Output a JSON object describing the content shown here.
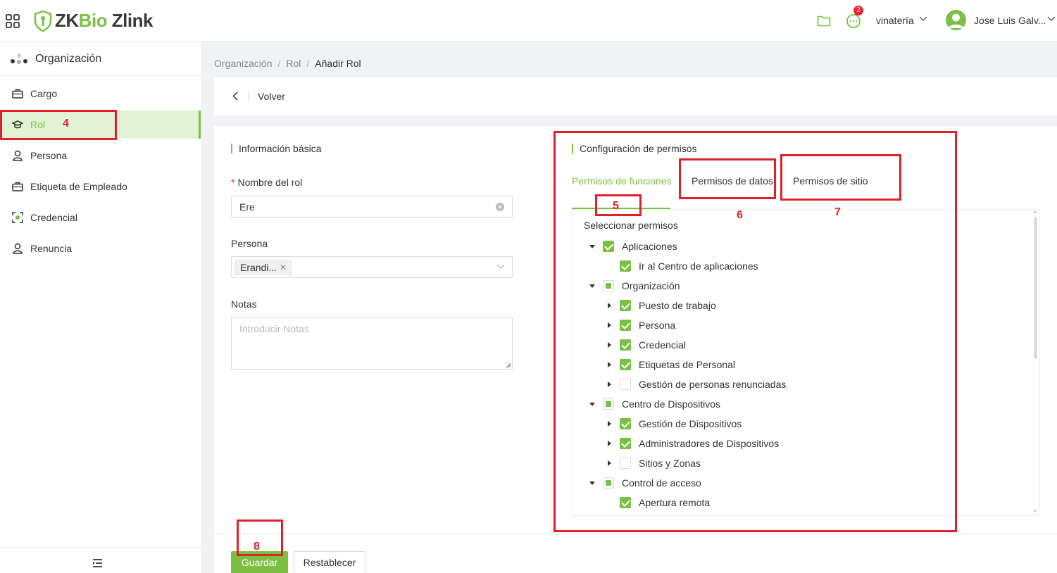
{
  "header": {
    "logo_zk": "ZK",
    "logo_bio": "Bio",
    "logo_zlink": " Zlink",
    "notification_count": "2",
    "company": "vinatería",
    "username": "Jose Luis Galv..."
  },
  "sidebar": {
    "title": "Organización",
    "items": [
      {
        "label": "Cargo",
        "icon": "briefcase-icon"
      },
      {
        "label": "Rol",
        "icon": "graduation-cap-icon",
        "active": true
      },
      {
        "label": "Persona",
        "icon": "person-icon"
      },
      {
        "label": "Etiqueta de Empleado",
        "icon": "briefcase-icon"
      },
      {
        "label": "Credencial",
        "icon": "credential-icon"
      },
      {
        "label": "Renuncia",
        "icon": "person-icon"
      }
    ]
  },
  "breadcrumb": [
    "Organización",
    "Rol",
    "Añadir Rol"
  ],
  "back_label": "Volver",
  "basic_info": {
    "title": "Información básica",
    "role_name_label": "Nombre del rol",
    "role_name_required": "*",
    "role_name_value": "Ere",
    "person_label": "Persona",
    "person_tag": "Erandi...",
    "notes_label": "Notas",
    "notes_placeholder": "Introducir Notas"
  },
  "permissions": {
    "title": "Configuración de permisos",
    "tabs": [
      "Permisos de funciones",
      "Permisos de datos",
      "Permisos de sitio"
    ],
    "active_tab": "Permisos de funciones",
    "select_label": "Seleccionar permisos",
    "tree": [
      {
        "label": "Aplicaciones",
        "level": 0,
        "caret": "down",
        "state": "checked"
      },
      {
        "label": "Ir al Centro de aplicaciones",
        "level": 1,
        "caret": "none",
        "state": "checked"
      },
      {
        "label": "Organización",
        "level": 0,
        "caret": "down",
        "state": "partial"
      },
      {
        "label": "Puesto de trabajo",
        "level": 1,
        "caret": "right",
        "state": "checked"
      },
      {
        "label": "Persona",
        "level": 1,
        "caret": "right",
        "state": "checked"
      },
      {
        "label": "Credencial",
        "level": 1,
        "caret": "right",
        "state": "checked"
      },
      {
        "label": "Etiquetas de Personal",
        "level": 1,
        "caret": "right",
        "state": "checked"
      },
      {
        "label": "Gestión de personas renunciadas",
        "level": 1,
        "caret": "right",
        "state": "unchecked"
      },
      {
        "label": "Centro de Dispositivos",
        "level": 0,
        "caret": "down",
        "state": "partial"
      },
      {
        "label": "Gestión de Dispositivos",
        "level": 1,
        "caret": "right",
        "state": "checked"
      },
      {
        "label": "Administradores de Dispositivos",
        "level": 1,
        "caret": "right",
        "state": "checked"
      },
      {
        "label": "Sitios y Zonas",
        "level": 1,
        "caret": "right",
        "state": "unchecked"
      },
      {
        "label": "Control de acceso",
        "level": 0,
        "caret": "down",
        "state": "partial"
      },
      {
        "label": "Apertura remota",
        "level": 1,
        "caret": "none",
        "state": "checked"
      }
    ]
  },
  "buttons": {
    "save": "Guardar",
    "reset": "Restablecer"
  },
  "annotations": [
    "4",
    "5",
    "6",
    "7",
    "8"
  ],
  "colors": {
    "accent": "#7ac143",
    "annotation": "#e0202a",
    "badge": "#f5222d"
  }
}
